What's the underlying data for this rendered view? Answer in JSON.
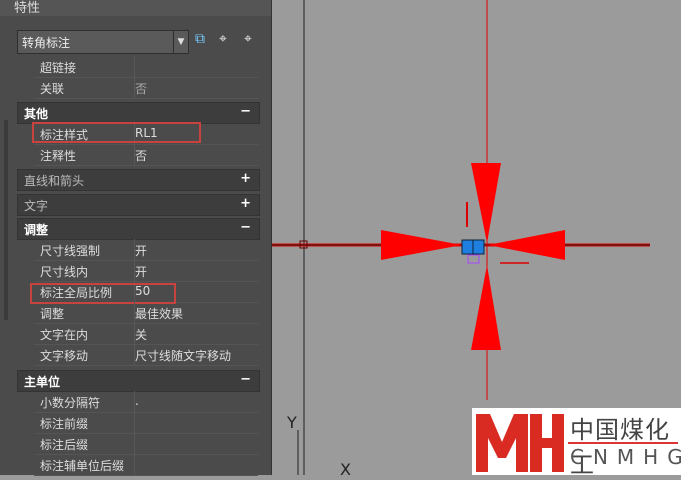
{
  "panel": {
    "title": "特性",
    "selector": "转角标注"
  },
  "rows_top": [
    {
      "label": "超链接",
      "value": ""
    },
    {
      "label": "关联",
      "value": "否"
    }
  ],
  "sections": [
    {
      "title": "其他",
      "toggle": "−",
      "rows": [
        {
          "label": "标注样式",
          "value": "RL1"
        },
        {
          "label": "注释性",
          "value": "否"
        }
      ]
    },
    {
      "title": "直线和箭头",
      "toggle": "+"
    },
    {
      "title": "文字",
      "toggle": "+"
    },
    {
      "title": "调整",
      "toggle": "−",
      "rows": [
        {
          "label": "尺寸线强制",
          "value": "开"
        },
        {
          "label": "尺寸线内",
          "value": "开"
        },
        {
          "label": "标注全局比例",
          "value": "50"
        },
        {
          "label": "调整",
          "value": "最佳效果"
        },
        {
          "label": "文字在内",
          "value": "关"
        },
        {
          "label": "文字移动",
          "value": "尺寸线随文字移动"
        }
      ]
    },
    {
      "title": "主单位",
      "toggle": "−",
      "rows": [
        {
          "label": "小数分隔符",
          "value": "."
        },
        {
          "label": "标注前缀",
          "value": ""
        },
        {
          "label": "标注后缀",
          "value": ""
        },
        {
          "label": "标注辅单位后缀",
          "value": ""
        }
      ]
    }
  ],
  "canvas": {
    "ucs_y": "Y",
    "ucs_x": "X",
    "dim_color": "#ff0000",
    "grip_color": "#1e7fe0"
  },
  "logo": {
    "mark": "MH",
    "cn": "中国煤化工",
    "en": "CNMHG"
  }
}
